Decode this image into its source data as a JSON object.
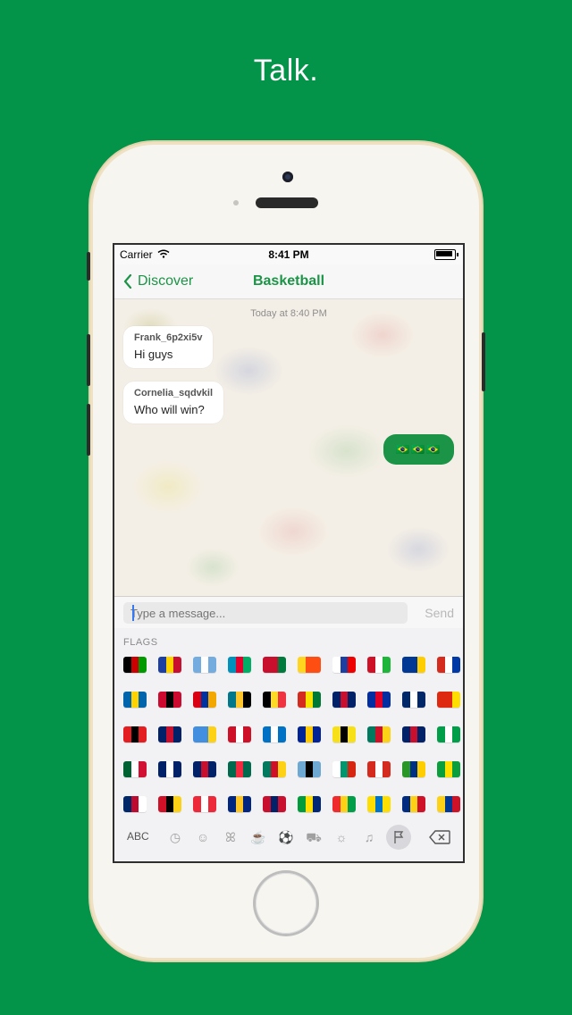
{
  "headline": "Talk.",
  "status": {
    "carrier": "Carrier",
    "time": "8:41 PM"
  },
  "nav": {
    "back_label": "Discover",
    "title": "Basketball"
  },
  "chat": {
    "timestamp": "Today at 8:40 PM",
    "messages": [
      {
        "sender": "Frank_6p2xi5v",
        "text": "Hi guys"
      },
      {
        "sender": "Cornelia_sqdvkil",
        "text": "Who will win?"
      }
    ],
    "outgoing": "🇧🇷🇧🇷🇧🇷"
  },
  "input": {
    "placeholder": "Type a message...",
    "send_label": "Send"
  },
  "keyboard": {
    "section_label": "FLAGS",
    "abc_label": "ABC",
    "categories": [
      "recent-icon",
      "smiley-icon",
      "animal-icon",
      "food-icon",
      "sport-icon",
      "travel-icon",
      "object-icon",
      "symbol-icon",
      "flag-icon"
    ]
  },
  "colors": {
    "accent": "#1c9447",
    "background": "#03944a"
  }
}
